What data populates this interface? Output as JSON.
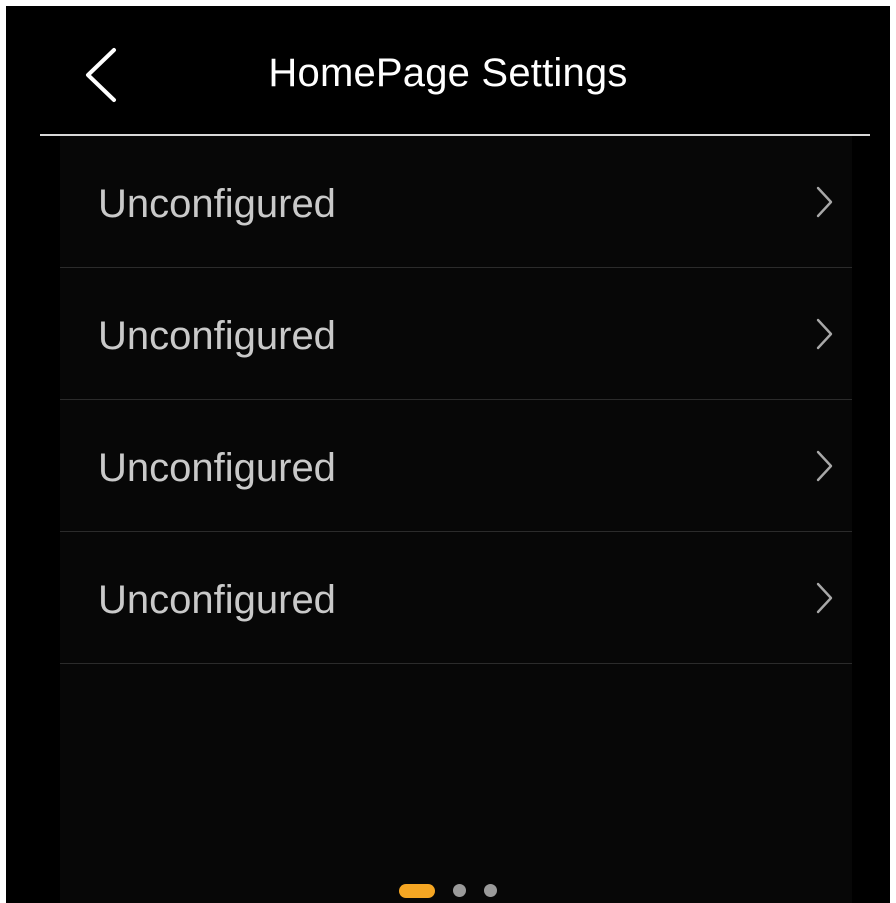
{
  "header": {
    "title": "HomePage Settings",
    "back_icon": "chevron-left-icon"
  },
  "list": {
    "items": [
      {
        "label": "Unconfigured",
        "icon": "chevron-right-icon"
      },
      {
        "label": "Unconfigured",
        "icon": "chevron-right-icon"
      },
      {
        "label": "Unconfigured",
        "icon": "chevron-right-icon"
      },
      {
        "label": "Unconfigured",
        "icon": "chevron-right-icon"
      }
    ]
  },
  "pager": {
    "pages": 3,
    "current": 1
  },
  "colors": {
    "background": "#000000",
    "panel": "#070707",
    "title_text": "#ffffff",
    "item_text": "#c9c9c9",
    "divider": "#2b2b2b",
    "header_divider": "#d8d8d8",
    "accent": "#f5a623",
    "dot_inactive": "#9a9a9a",
    "chevron": "#a8a8a8"
  }
}
